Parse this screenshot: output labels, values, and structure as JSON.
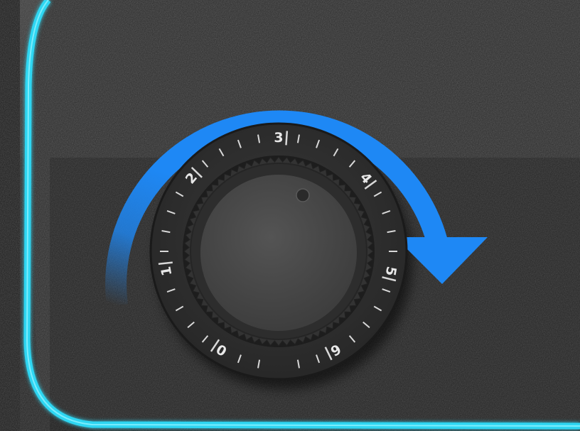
{
  "image": {
    "subject": "rotary-dial-knob",
    "colors": {
      "background_upper": "#3a3a3a",
      "background_lower": "#262626",
      "panel_edge_glow": "#2fd6f2",
      "arrow": "#1e88f5",
      "dial_ring": "#2e2e2e",
      "knob_face": "#4a4a4a",
      "tick": "#d8d8d8",
      "number": "#e8e8e8"
    },
    "dial": {
      "numbers": [
        "0",
        "1",
        "2",
        "3",
        "4",
        "5",
        "6"
      ],
      "arrow_direction": "clockwise"
    }
  }
}
